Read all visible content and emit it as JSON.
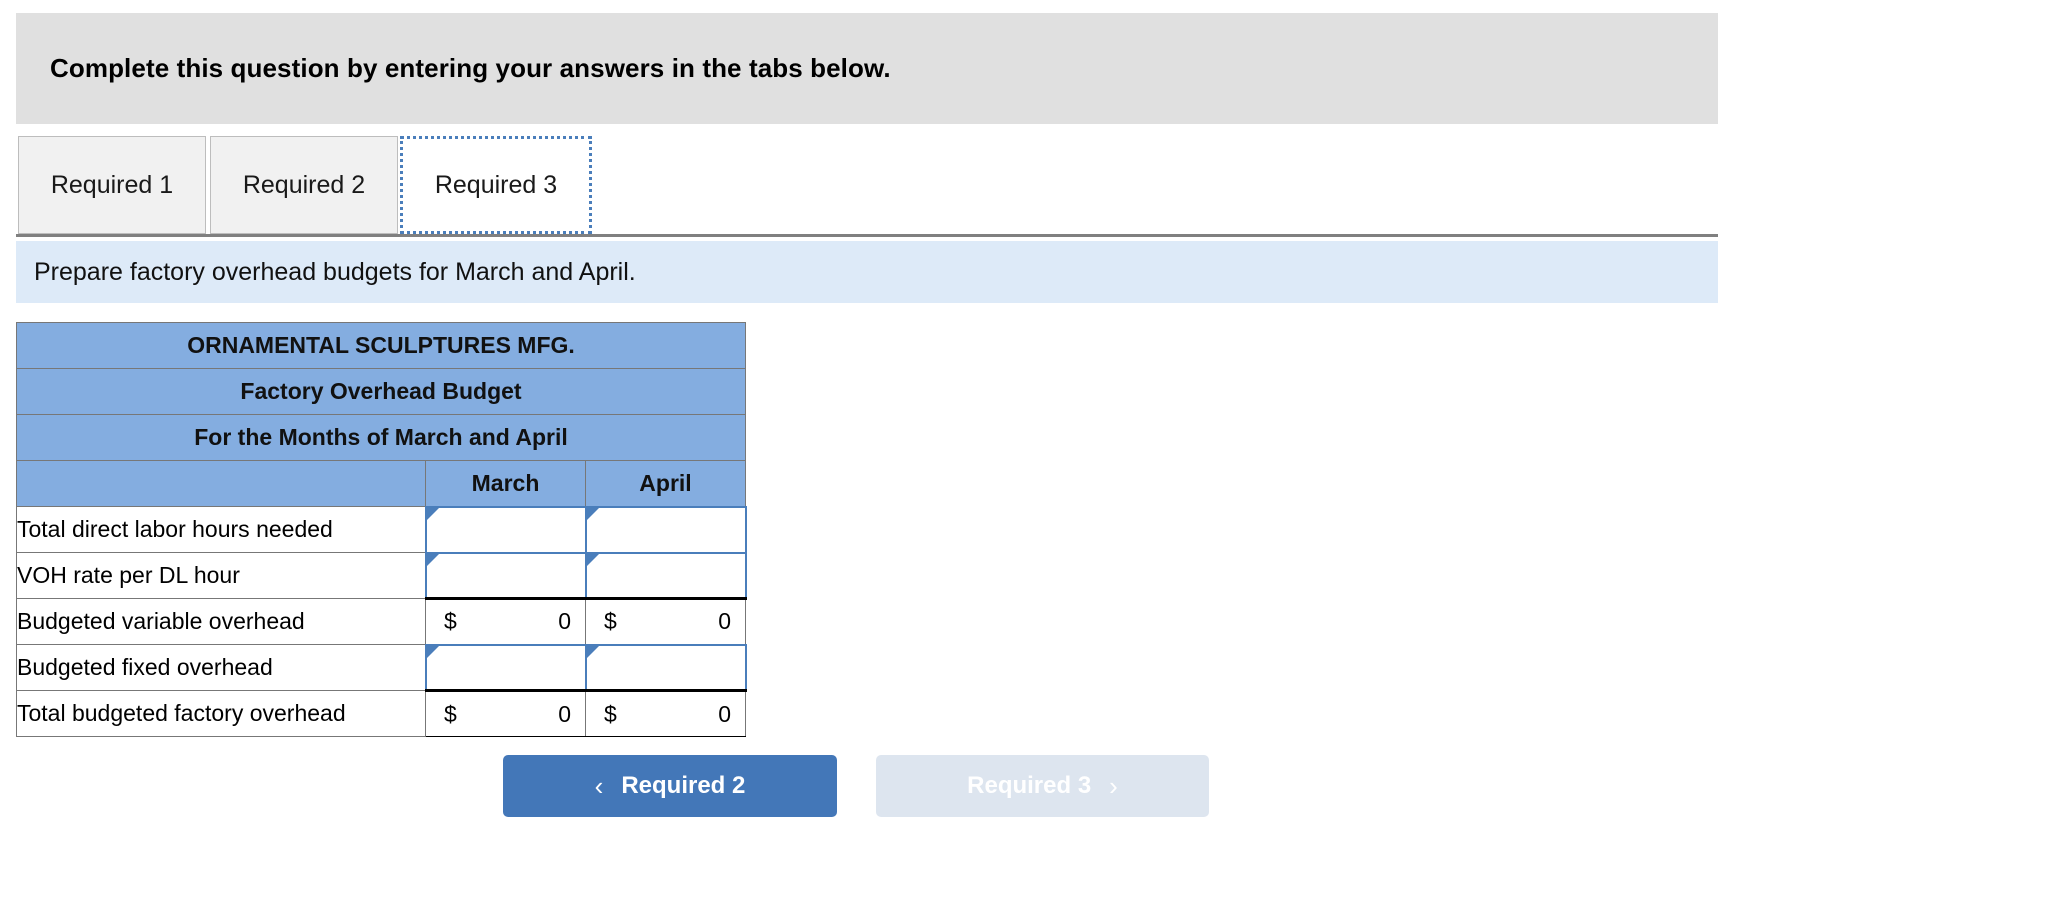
{
  "banner": {
    "text": "Complete this question by entering your answers in the tabs below."
  },
  "tabs": [
    {
      "label": "Required 1",
      "active": false
    },
    {
      "label": "Required 2",
      "active": false
    },
    {
      "label": "Required 3",
      "active": true
    }
  ],
  "prompt": {
    "text": "Prepare factory overhead budgets for March and April."
  },
  "table": {
    "title_lines": [
      "ORNAMENTAL SCULPTURES MFG.",
      "Factory Overhead Budget",
      "For the Months of March and April"
    ],
    "column_headers": [
      "",
      "March",
      "April"
    ],
    "rows": [
      {
        "label": "Total direct labor hours needed",
        "type": "input",
        "march": "",
        "april": ""
      },
      {
        "label": "VOH rate per DL hour",
        "type": "input",
        "march": "",
        "april": ""
      },
      {
        "label": "Budgeted variable overhead",
        "type": "value",
        "march_symbol": "$",
        "march": "0",
        "april_symbol": "$",
        "april": "0"
      },
      {
        "label": "Budgeted fixed overhead",
        "type": "input",
        "march": "",
        "april": ""
      },
      {
        "label": "Total budgeted factory overhead",
        "type": "value-total",
        "march_symbol": "$",
        "march": "0",
        "april_symbol": "$",
        "april": "0"
      }
    ]
  },
  "nav": {
    "prev_label": "Required 2",
    "prev_chevron": "‹",
    "next_label": "Required 3",
    "next_chevron": "›"
  },
  "colors": {
    "banner_gray": "#e0e0e0",
    "prompt_blue": "#ddeaf8",
    "table_header_blue": "#84ade0",
    "input_border_blue": "#4a7ebb",
    "button_active_blue": "#4377b8",
    "button_disabled_blue": "#dde5ef"
  }
}
